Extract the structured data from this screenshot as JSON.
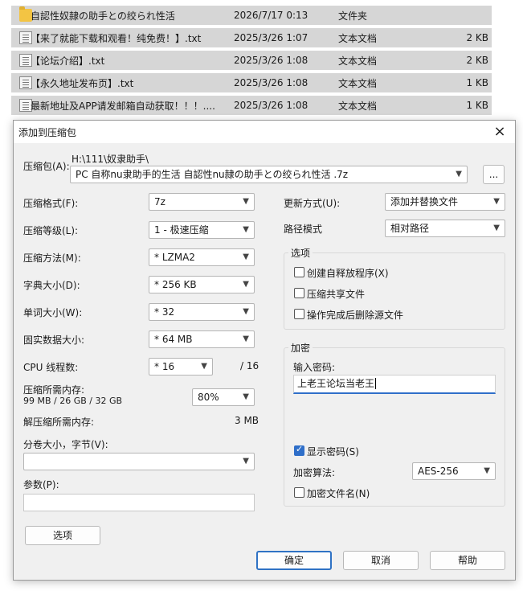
{
  "files": [
    {
      "name": "自認性奴隷の助手との绞られ性活",
      "date": "2026/7/17 0:13",
      "type": "文件夹",
      "size": "",
      "icon": "folder-icon"
    },
    {
      "name": "【来了就能下载和观看！纯免费！】.txt",
      "date": "2025/3/26 1:07",
      "type": "文本文档",
      "size": "2 KB",
      "icon": "txt-icon"
    },
    {
      "name": "【论坛介绍】.txt",
      "date": "2025/3/26 1:08",
      "type": "文本文档",
      "size": "2 KB",
      "icon": "txt-icon"
    },
    {
      "name": "【永久地址发布页】.txt",
      "date": "2025/3/26 1:08",
      "type": "文本文档",
      "size": "1 KB",
      "icon": "txt-icon"
    },
    {
      "name": "最新地址及APP请发邮箱自动获取！！！....",
      "date": "2025/3/26 1:08",
      "type": "文本文档",
      "size": "1 KB",
      "icon": "txt-icon"
    }
  ],
  "dialog": {
    "title": "添加到压缩包",
    "close": "×",
    "archive_label": "压缩包(A):",
    "archive_path": "H:\\111\\奴隶助手\\",
    "archive_name": "PC 自称nu隶助手的生活 自認性nu隷の助手との绞られ性活 .7z",
    "browse": "...",
    "format_label": "压缩格式(F):",
    "format_value": "7z",
    "level_label": "压缩等级(L):",
    "level_value": "1 - 极速压缩",
    "method_label": "压缩方法(M):",
    "method_value": "* LZMA2",
    "dict_label": "字典大小(D):",
    "dict_value": "* 256 KB",
    "word_label": "单词大小(W):",
    "word_value": "* 32",
    "solid_label": "固实数据大小:",
    "solid_value": "* 64 MB",
    "cpu_label": "CPU 线程数:",
    "cpu_value": "* 16",
    "cpu_max": "/ 16",
    "mem_label": "压缩所需内存:",
    "mem_detail": "99 MB / 26 GB / 32 GB",
    "mem_percent": "80%",
    "decomp_label": "解压缩所需内存:",
    "decomp_value": "3 MB",
    "split_label": "分卷大小，字节(V):",
    "split_value": "",
    "params_label": "参数(P):",
    "params_value": "",
    "options_button": "选项",
    "update_label": "更新方式(U):",
    "update_value": "添加并替换文件",
    "path_label": "路径模式",
    "path_value": "相对路径",
    "options_group": "选项",
    "opt_sfx": "创建自释放程序(X)",
    "opt_shared": "压缩共享文件",
    "opt_delete": "操作完成后删除源文件",
    "encrypt_group": "加密",
    "password_label": "输入密码:",
    "password_value": "上老王论坛当老王",
    "show_password": "显示密码(S)",
    "enc_method_label": "加密算法:",
    "enc_method_value": "AES-256",
    "enc_names": "加密文件名(N)",
    "ok": "确定",
    "cancel": "取消",
    "help": "帮助"
  },
  "colors": {
    "accent": "#2f6fc9",
    "row_bg": "#d6d6d6",
    "dialog_bg": "#f0f0f0"
  }
}
